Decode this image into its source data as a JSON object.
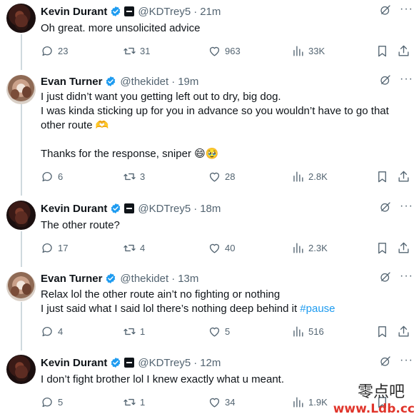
{
  "tweets": [
    {
      "author": "Kevin Durant",
      "handle": "@KDTrey5",
      "time": "21m",
      "text": "Oh great. more unsolicited advice",
      "replies": "23",
      "retweets": "31",
      "likes": "963",
      "views": "33K"
    },
    {
      "author": "Evan Turner",
      "handle": "@thekidet",
      "time": "19m",
      "text": "I just didn’t want you getting left out to dry, big dog.\nI was kinda sticking up for you in advance so you wouldn’t have to go that\nother route 🫶\n\nThanks for the response, sniper 😄🥹",
      "replies": "6",
      "retweets": "3",
      "likes": "28",
      "views": "2.8K"
    },
    {
      "author": "Kevin Durant",
      "handle": "@KDTrey5",
      "time": "18m",
      "text": "The other route?",
      "replies": "17",
      "retweets": "4",
      "likes": "40",
      "views": "2.3K"
    },
    {
      "author": "Evan Turner",
      "handle": "@thekidet",
      "time": "13m",
      "text": "Relax lol the other route ain’t no fighting or nothing\nI just said what I said lol there’s nothing deep behind it ",
      "hashtag": "#pause",
      "replies": "4",
      "retweets": "1",
      "likes": "5",
      "views": "516"
    },
    {
      "author": "Kevin Durant",
      "handle": "@KDTrey5",
      "time": "12m",
      "text": "I don’t fight brother lol I knew exactly what u meant.",
      "replies": "5",
      "retweets": "1",
      "likes": "34",
      "views": "1.9K"
    }
  ],
  "separator": "·",
  "more_glyph": "···",
  "watermark": {
    "chinese": "零点吧",
    "url": "www.Ldb.cc"
  },
  "colors": {
    "verified": "#1d9bf0",
    "hashtag": "#1d9bf0",
    "secondary": "#536471",
    "watermark_url": "#e0352b"
  },
  "icons": [
    "verified-badge-icon",
    "affiliation-badge-icon",
    "grok-icon",
    "more-icon",
    "reply-icon",
    "retweet-icon",
    "like-icon",
    "views-icon",
    "bookmark-icon",
    "share-icon"
  ]
}
